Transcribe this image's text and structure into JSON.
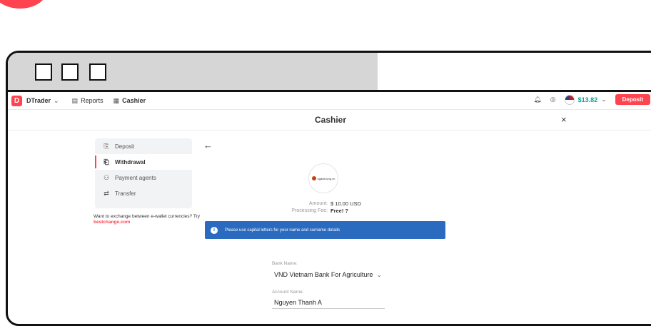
{
  "window": {
    "control_boxes": 3
  },
  "header": {
    "logo_letter": "D",
    "trader_label": "DTrader",
    "reports_label": "Reports",
    "cashier_label": "Cashier",
    "balance": "$13.82",
    "deposit_label": "Deposit"
  },
  "page": {
    "title": "Cashier",
    "close": "×"
  },
  "sidebar": {
    "items": [
      {
        "icon": "deposit-icon",
        "label": "Deposit"
      },
      {
        "icon": "withdrawal-icon",
        "label": "Withdrawal",
        "active": true
      },
      {
        "icon": "payment-agents-icon",
        "label": "Payment agents"
      },
      {
        "icon": "transfer-icon",
        "label": "Transfer"
      }
    ],
    "note_text": "Want to exchange between e-wallet currencies? Try ",
    "note_link": "bestchange.com"
  },
  "main": {
    "provider_name": "ngânlượng.vn",
    "amount_label": "Amount:",
    "amount_value": "$ 10.00 USD",
    "fee_label": "Processing Fee:",
    "fee_value": "Free! ?",
    "info_text": "Please use capital letters for your name and surname details",
    "bank_label": "Bank Name:",
    "bank_value": "VND Vietnam Bank For Agriculture",
    "account_label": "Account Name:",
    "account_value": "Nguyen Thanh A"
  },
  "colors": {
    "accent": "#ff444f",
    "banner": "#2a6bc0",
    "balance": "#00a79e"
  }
}
